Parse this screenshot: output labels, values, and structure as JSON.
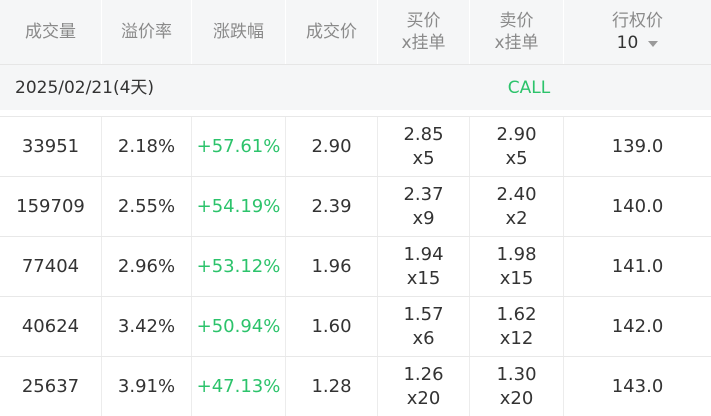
{
  "columns": [
    {
      "line1": "成交量",
      "line2": ""
    },
    {
      "line1": "溢价率",
      "line2": ""
    },
    {
      "line1": "涨跌幅",
      "line2": ""
    },
    {
      "line1": "成交价",
      "line2": ""
    },
    {
      "line1": "买价",
      "line2": "x挂单"
    },
    {
      "line1": "卖价",
      "line2": "x挂单"
    },
    {
      "line1": "行权价",
      "line2": "10"
    }
  ],
  "expiry": {
    "date": "2025/02/21(4天)",
    "type": "CALL"
  },
  "rows": [
    {
      "volume": "33951",
      "premium": "2.18%",
      "change": "+57.61%",
      "last": "2.90",
      "bid": "2.85",
      "bid_size": "x5",
      "ask": "2.90",
      "ask_size": "x5",
      "strike": "139.0"
    },
    {
      "volume": "159709",
      "premium": "2.55%",
      "change": "+54.19%",
      "last": "2.39",
      "bid": "2.37",
      "bid_size": "x9",
      "ask": "2.40",
      "ask_size": "x2",
      "strike": "140.0"
    },
    {
      "volume": "77404",
      "premium": "2.96%",
      "change": "+53.12%",
      "last": "1.96",
      "bid": "1.94",
      "bid_size": "x15",
      "ask": "1.98",
      "ask_size": "x15",
      "strike": "141.0"
    },
    {
      "volume": "40624",
      "premium": "3.42%",
      "change": "+50.94%",
      "last": "1.60",
      "bid": "1.57",
      "bid_size": "x6",
      "ask": "1.62",
      "ask_size": "x12",
      "strike": "142.0"
    },
    {
      "volume": "25637",
      "premium": "3.91%",
      "change": "+47.13%",
      "last": "1.28",
      "bid": "1.26",
      "bid_size": "x20",
      "ask": "1.30",
      "ask_size": "x20",
      "strike": "143.0"
    }
  ],
  "colors": {
    "up": "#2cc36b",
    "header_bg": "#f5f6f7",
    "header_text": "#8a8a8a",
    "text": "#333333"
  }
}
